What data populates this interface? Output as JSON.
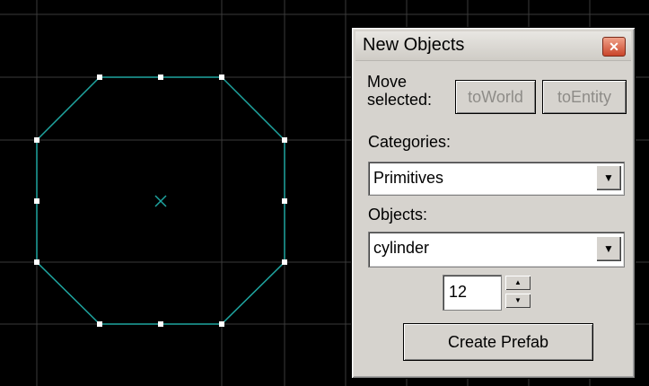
{
  "viewport": {
    "grid_color": "#3a3a3a",
    "shape_color": "#1fa5a0",
    "handle_color": "#ffffff"
  },
  "panel": {
    "title": "New Objects",
    "close_symbol": "✕",
    "move_label_line1": "Move",
    "move_label_line2": "selected:",
    "to_world_label": "toWorld",
    "to_entity_label": "toEntity",
    "categories_label": "Categories:",
    "categories_value": "Primitives",
    "objects_label": "Objects:",
    "objects_value": "cylinder",
    "sides_value": "12",
    "create_prefab_label": "Create Prefab"
  }
}
